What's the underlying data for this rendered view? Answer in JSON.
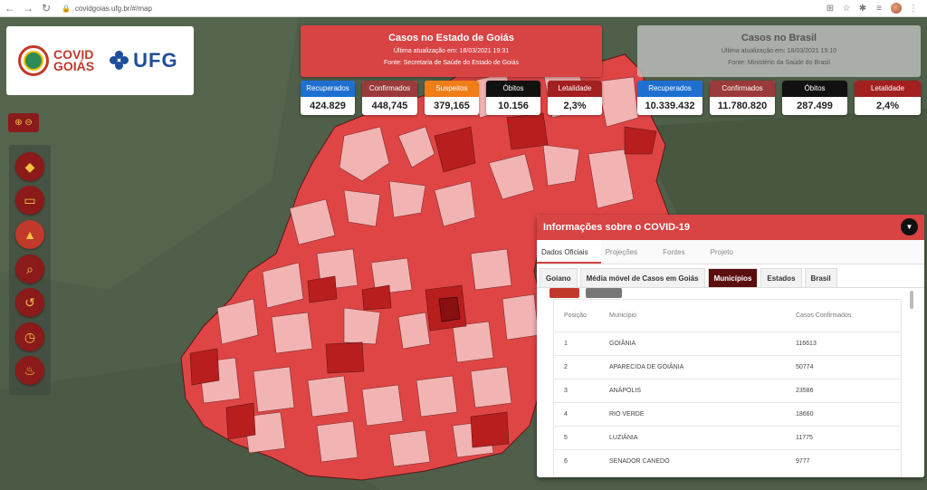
{
  "browser": {
    "url": "covidgoias.ufg.br/#/map"
  },
  "logos": {
    "covid_line1": "COVID",
    "covid_line2": "GOIÁS",
    "ufg": "UFG"
  },
  "goias": {
    "title": "Casos no Estado de Goiás",
    "updated": "Última atualização em: 18/03/2021 19:31",
    "source": "Fonte: Secretaria de Saúde do Estado de Goiás",
    "stats": [
      {
        "label": "Recuperados",
        "value": "424.829",
        "color": "#1f6fd1"
      },
      {
        "label": "Confirmados",
        "value": "448,745",
        "color": "#9b3a3a"
      },
      {
        "label": "Suspeitos",
        "value": "379,165",
        "color": "#ef7d18"
      },
      {
        "label": "Óbitos",
        "value": "10.156",
        "color": "#111111"
      },
      {
        "label": "Letalidade",
        "value": "2,3%",
        "color": "#a32020"
      }
    ]
  },
  "brasil": {
    "title": "Casos no Brasil",
    "updated": "Última atualização em: 18/03/2021 19:10",
    "source": "Fonte: Ministério da Saúde do Brasil",
    "stats": [
      {
        "label": "Recuperados",
        "value": "10.339.432",
        "color": "#1f6fd1"
      },
      {
        "label": "Confirmados",
        "value": "11.780.820",
        "color": "#9b3a3a"
      },
      {
        "label": "Óbitos",
        "value": "287.499",
        "color": "#111111"
      },
      {
        "label": "Letalidade",
        "value": "2,4%",
        "color": "#a32020"
      }
    ]
  },
  "info": {
    "title": "Informações sobre o COVID-19",
    "main_tabs": [
      "Dados Oficiais",
      "Projeções",
      "Fontes",
      "Projeto"
    ],
    "sub_tabs": [
      "Goiano",
      "Média móvel de Casos em Goiás",
      "Municípios",
      "Estados",
      "Brasil"
    ],
    "table": {
      "headers": [
        "Posição",
        "Município",
        "Casos Confirmados"
      ],
      "rows": [
        [
          "1",
          "GOIÂNIA",
          "116613"
        ],
        [
          "2",
          "APARECIDA DE GOIÂNIA",
          "50774"
        ],
        [
          "3",
          "ANÁPOLIS",
          "23586"
        ],
        [
          "4",
          "RIO VERDE",
          "18660"
        ],
        [
          "5",
          "LUZIÂNIA",
          "11775"
        ],
        [
          "6",
          "SENADOR CANEDO",
          "9777"
        ]
      ]
    }
  },
  "map_colors": {
    "light": "#f2b3b3",
    "mid": "#e04545",
    "dark": "#b81e1e",
    "darkest": "#8a1010",
    "border": "#5a1818"
  }
}
